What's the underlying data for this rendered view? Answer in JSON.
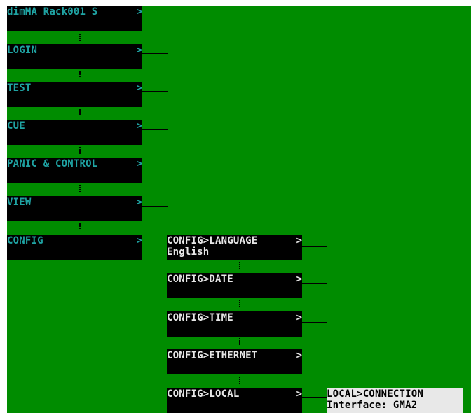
{
  "colors": {
    "background": "#008c00",
    "node_bg": "#000000",
    "main_text": "#1fa3a3",
    "sub_text": "#e6e6e6",
    "leaf_bg": "#e8e8e8",
    "leaf_text": "#000000"
  },
  "arrow_glyph": ">",
  "main_menu": [
    {
      "id": "header",
      "label": "dimMA Rack001 S"
    },
    {
      "id": "login",
      "label": "LOGIN"
    },
    {
      "id": "test",
      "label": "TEST"
    },
    {
      "id": "cue",
      "label": "CUE"
    },
    {
      "id": "panic",
      "label": "PANIC & CONTROL"
    },
    {
      "id": "view",
      "label": "VIEW"
    },
    {
      "id": "config",
      "label": "CONFIG"
    }
  ],
  "config_menu": [
    {
      "id": "language",
      "label": "CONFIG>LANGUAGE",
      "value": "English"
    },
    {
      "id": "date",
      "label": "CONFIG>DATE",
      "value": ""
    },
    {
      "id": "time",
      "label": "CONFIG>TIME",
      "value": ""
    },
    {
      "id": "ethernet",
      "label": "CONFIG>ETHERNET",
      "value": ""
    },
    {
      "id": "local",
      "label": "CONFIG>LOCAL",
      "value": ""
    }
  ],
  "local_menu": {
    "label": "LOCAL>CONNECTION",
    "value": "Interface: GMA2"
  }
}
